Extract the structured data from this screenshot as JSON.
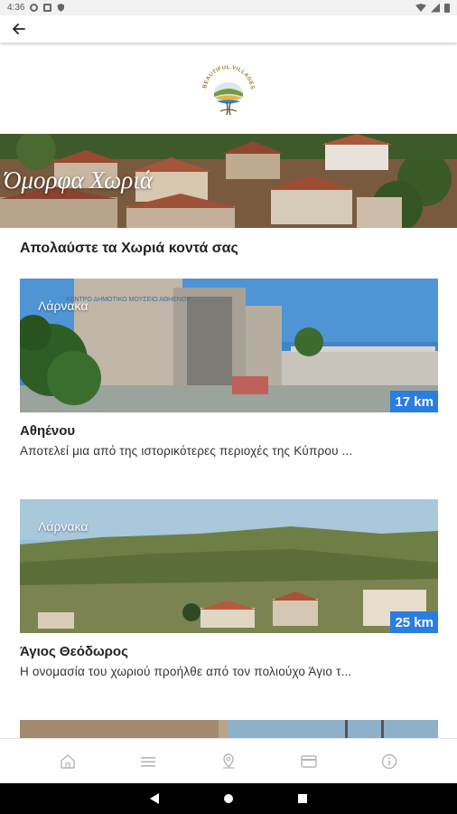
{
  "status_bar": {
    "time": "4:36"
  },
  "app_bar": {
    "back_icon": "arrow-back-icon"
  },
  "logo": {
    "text": "BEAUTIFUL VILLAGES OF CYPRUS"
  },
  "hero": {
    "title": "Όμορφα Χωριά"
  },
  "section": {
    "title": "Απολαύστε τα Χωριά κοντά σας"
  },
  "cards": [
    {
      "region": "Λάρνακα",
      "distance": "17 km",
      "title": "Αθηένου",
      "description": "Αποτελεί μια από της ιστορικότερες περιοχές της Κύπρου ...",
      "sign_text": "ΚΕΝΤΡΟ ΔΗΜΟΤΙΚΟ ΜΟΥΣΕΙΟ ΑΘΗΕΝΟΥ"
    },
    {
      "region": "Λάρνακα",
      "distance": "25 km",
      "title": "Άγιος Θεόδωρος",
      "description": "Η ονομασία του χωριού προήλθε από τον πολιούχο Άγιο τ..."
    }
  ],
  "bottom_nav": [
    {
      "icon": "home-icon"
    },
    {
      "icon": "list-icon"
    },
    {
      "icon": "map-pin-icon"
    },
    {
      "icon": "card-icon"
    },
    {
      "icon": "info-icon"
    }
  ],
  "colors": {
    "accent": "#2a7de1"
  }
}
